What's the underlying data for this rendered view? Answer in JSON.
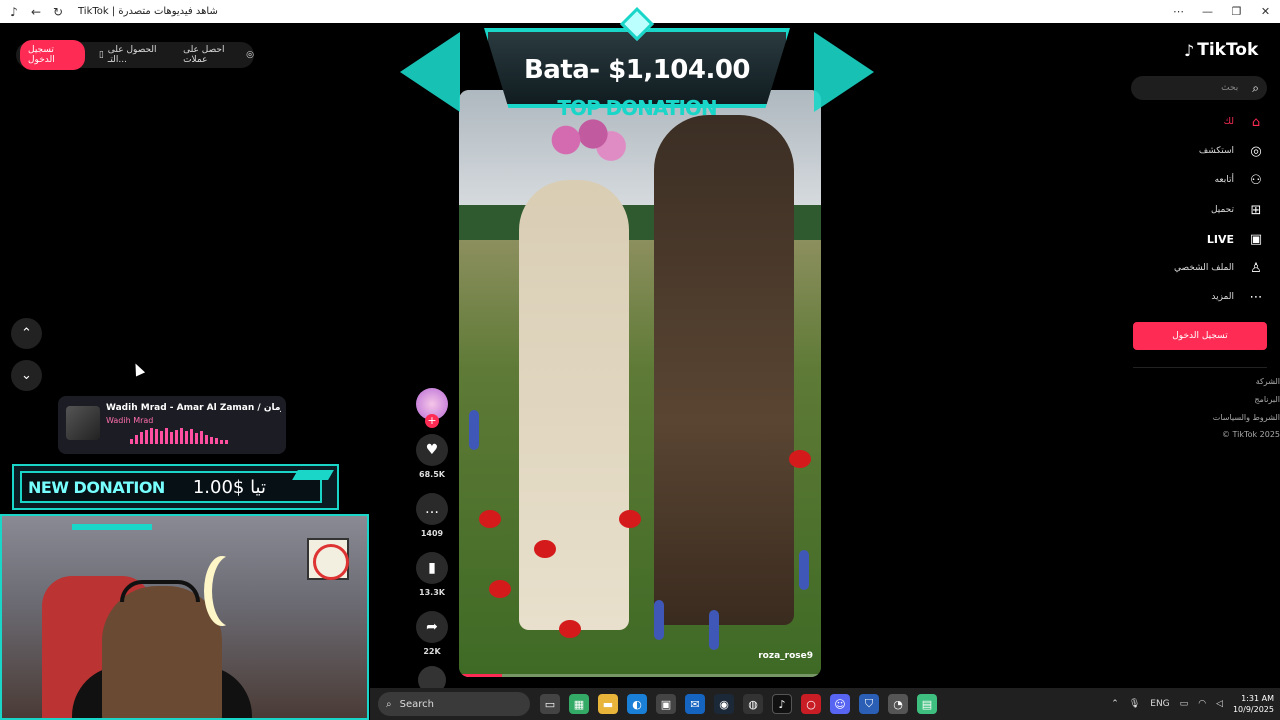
{
  "window": {
    "title": "TikTok | شاهد فيديوهات متصدرة",
    "controls": [
      "⋯",
      "—",
      "❐",
      "✕"
    ]
  },
  "top_pills": {
    "login": "تسجيل الدخول",
    "get_app": "الحصول على التـ...",
    "get_coins": "احصل على عملات"
  },
  "nav": {
    "up_icon": "chevron-up-icon",
    "down_icon": "chevron-down-icon"
  },
  "music": {
    "title": "Wadih Mrad - Amar Al Zaman / زمان...",
    "artist": "Wadih Mrad"
  },
  "new_donation": {
    "label": "NEW DONATION",
    "amount": "تيا $1.00"
  },
  "top_donation": {
    "amount": "Bata- $1,104.00",
    "label": "TOP DONATION"
  },
  "video": {
    "watermark": "roza_rose9",
    "progress": 0.12
  },
  "actions": {
    "likes": "68.5K",
    "comments": "1409",
    "saves": "13.3K",
    "shares": "22K"
  },
  "sidebar": {
    "logo": "TikTok",
    "search_placeholder": "بحث",
    "items": [
      {
        "label": "لك",
        "icon": "home-icon"
      },
      {
        "label": "استكشف",
        "icon": "compass-icon"
      },
      {
        "label": "أتابعه",
        "icon": "following-icon"
      },
      {
        "label": "تحميل",
        "icon": "upload-icon"
      },
      {
        "label": "LIVE",
        "icon": "live-icon"
      },
      {
        "label": "الملف الشخصي",
        "icon": "profile-icon"
      },
      {
        "label": "المزيد",
        "icon": "more-icon"
      }
    ],
    "login_button": "تسجيل الدخول",
    "footer": [
      "الشركة",
      "البرنامج",
      "الشروط والسياسات",
      "© TikTok 2025"
    ]
  },
  "taskbar": {
    "search": "Search",
    "lang": "ENG",
    "time": "1:31 AM",
    "date": "10/9/2025"
  },
  "colors": {
    "accent": "#fe2c55",
    "cyan": "#19d6c8"
  }
}
